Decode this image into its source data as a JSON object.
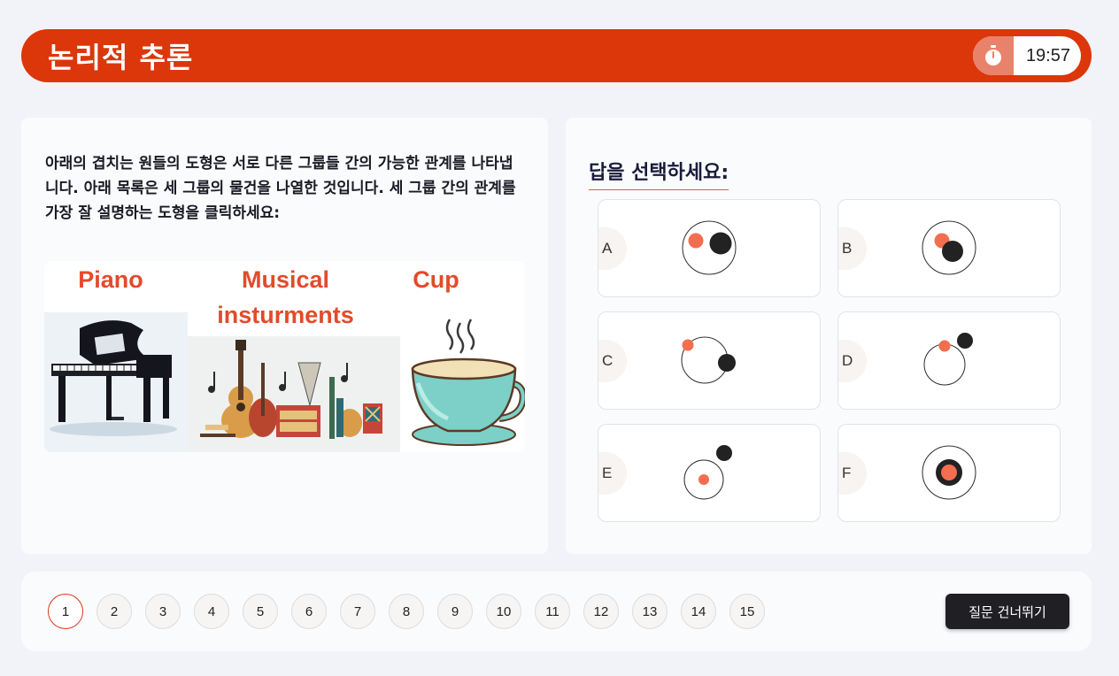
{
  "header": {
    "title": "논리적 추론",
    "timer": "19:57"
  },
  "question": {
    "text": "아래의 겹치는 원들의 도형은 서로 다른 그룹들 간의 가능한 관계를 나타냅니다. 아래 목록은 세 그룹의 물건을 나열한 것입니다. 세 그룹 간의 관계를 가장 잘 설명하는 도형을 클릭하세요:",
    "illustration": {
      "labels": [
        "Piano",
        "Musical",
        "insturments",
        "Cup"
      ]
    }
  },
  "answers": {
    "title": "답을 선택하세요:",
    "options": [
      {
        "letter": "A",
        "diagram": "orange-dot-and-black-dot-inside-circle"
      },
      {
        "letter": "B",
        "diagram": "overlapping-dots-inside-circle"
      },
      {
        "letter": "C",
        "diagram": "dots-on-circle-edge"
      },
      {
        "letter": "D",
        "diagram": "orange-dot-on-circle-black-dot-outside"
      },
      {
        "letter": "E",
        "diagram": "orange-dot-inside-circle-black-dot-outside"
      },
      {
        "letter": "F",
        "diagram": "concentric-circles"
      }
    ]
  },
  "pagination": {
    "pages": [
      "1",
      "2",
      "3",
      "4",
      "5",
      "6",
      "7",
      "8",
      "9",
      "10",
      "11",
      "12",
      "13",
      "14",
      "15"
    ],
    "current": "1"
  },
  "skip_label": "질문 건너뛰기",
  "colors": {
    "accent": "#dc360b",
    "orange_dot": "#f26e4f",
    "black_dot": "#222222"
  }
}
